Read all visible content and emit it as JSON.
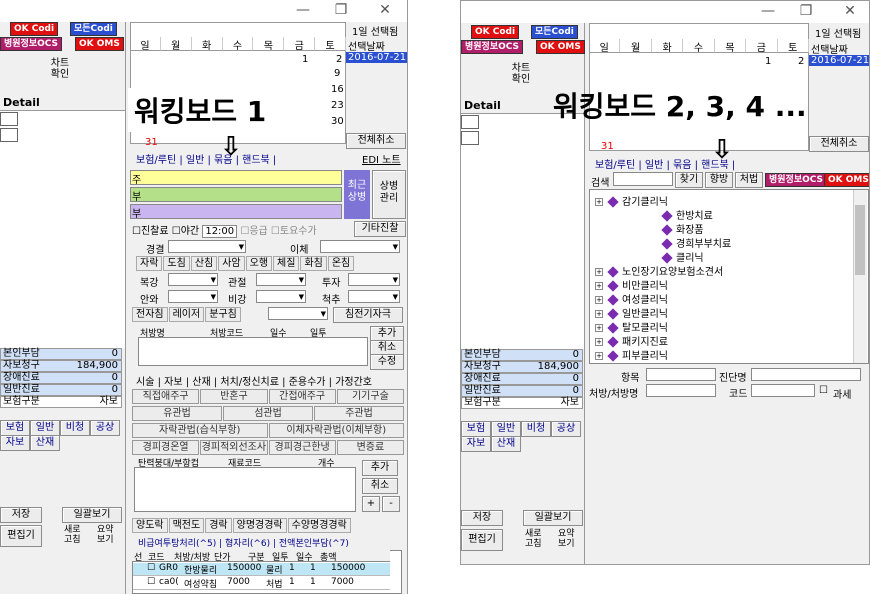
{
  "left": {
    "titlebar": {
      "min": "—",
      "restore": "❐",
      "close": "✕"
    },
    "top_pills": {
      "codi": "OK Codi",
      "allcodi": "모든Codi",
      "ocs": "병원정보OCS",
      "oms": "OK OMS"
    },
    "chart_confirm": "차트\n확인",
    "detail": "Detail",
    "calendar": {
      "days": [
        "일",
        "월",
        "화",
        "수",
        "목",
        "금",
        "토"
      ],
      "row1": [
        "1",
        "2"
      ],
      "side_title": "1일 선택됨",
      "side_label": "선택날짜",
      "side_date": "2016-07-21",
      "side_nums": [
        "9",
        "16",
        "23",
        "30"
      ],
      "sunday_31": "31",
      "cancel_all": "전체취소"
    },
    "caption": "워킹보드 1",
    "tabs": "보험/루틴 | 일반 | 묶음 | 핸드북 |",
    "edi_note": "EDI 노트",
    "diag_rows": [
      "주",
      "부",
      "부"
    ],
    "recent_disease": "최근\n상병",
    "disease_manage": "상병\n관리",
    "check_row": {
      "jinchal": "진찰료",
      "night": "야간",
      "time": "12:00",
      "emerg": "응급",
      "sat": "토요수가",
      "other": "기타진찰"
    },
    "proc1": {
      "kyungkeol": "경결",
      "ichae": "이체"
    },
    "proc_row2": [
      "자락",
      "도침",
      "산침",
      "사암",
      "오행",
      "체질",
      "화침",
      "온침"
    ],
    "proc3": {
      "bokgang": "복강",
      "gwanjeol": "관절",
      "tuja": "투자"
    },
    "proc4": {
      "anoe": "안와",
      "bigang": "비강",
      "cheokchu": "척추"
    },
    "proc5": [
      "전자침",
      "레이저",
      "분구침"
    ],
    "proc5_right": "침전기자극",
    "rx_header": [
      "처방명",
      "처방코드",
      "일수",
      "일투"
    ],
    "rx_buttons": [
      "추가",
      "취소",
      "수정"
    ],
    "section_tabs": "시술 | 자보 | 산재 | 처치/정신치료 | 준용수가 | 가정간호",
    "btn_rows": [
      [
        "직접애주구",
        "반혼구",
        "간접애주구",
        "기기구술"
      ],
      [
        "유관법",
        "섬관법",
        "주관법"
      ],
      [
        "자락관법(습식부항)",
        "이체자락관법(이체부항)"
      ],
      [
        "경피경온열",
        "경피적외선조사",
        "경피경근한냉",
        "변증료"
      ]
    ],
    "mat_header": [
      "탄력붕대/부항컵",
      "재료코드",
      "개수"
    ],
    "mat_buttons": [
      "추가",
      "취소",
      "+",
      "-"
    ],
    "bottom_tabs": [
      "양도락",
      "맥전도",
      "경락",
      "양명경경락",
      "수양명경경락"
    ],
    "fee_tabs": "비급여투탕처리(^5) | 형자리(^6) | 전액본인부담(^7)",
    "rx_table_header": [
      "선",
      "코드",
      "처방/처방",
      "단가",
      "구분",
      "일투",
      "일수",
      "총액"
    ],
    "rx_table_rows": [
      [
        "GR0",
        "한방물리",
        "150000",
        "물리",
        "1",
        "1",
        "150000"
      ],
      [
        "ca0(",
        "여성약침",
        "7000",
        "처법",
        "1",
        "1",
        "7000"
      ]
    ],
    "billing": [
      {
        "label": "본인부담",
        "value": "0"
      },
      {
        "label": "자보청구",
        "value": "184,900"
      },
      {
        "label": "장애진료",
        "value": "0"
      },
      {
        "label": "일반진료",
        "value": "0"
      },
      {
        "label": "보험구분",
        "value": "자보"
      }
    ],
    "insurance_tabs": [
      "보험",
      "일반",
      "비청",
      "공상"
    ],
    "insurance_tabs2": [
      "자보",
      "산재"
    ],
    "save": "저장",
    "bulk_view": "일괄보기",
    "editor": "편집기",
    "new_fetch": "새로\n고침",
    "summary": "요약\n보기"
  },
  "right": {
    "titlebar": {
      "min": "—",
      "restore": "❐",
      "close": "✕"
    },
    "chart_confirm": "차트\n확인",
    "detail": "Detail",
    "calendar": {
      "days": [
        "일",
        "월",
        "화",
        "수",
        "목",
        "금",
        "토"
      ],
      "row1": [
        "1",
        "2"
      ],
      "side_title": "1일 선택됨",
      "side_label": "선택날짜",
      "side_date": "2016-07-21",
      "sunday_31": "31",
      "cancel_all": "전체취소"
    },
    "caption": "워킹보드 2, 3, 4 ...",
    "tabs": "보험/루틴 | 일반 | 묶음 | 핸드북 |",
    "search_label": "검색",
    "find": "찾기",
    "hyangbang": "향방",
    "cheobeop": "처법",
    "tree": [
      {
        "t": "감기클리닉",
        "sub": false
      },
      {
        "t": "한방치료",
        "sub": true
      },
      {
        "t": "화장품",
        "sub": true
      },
      {
        "t": "경희부부치료",
        "sub": true
      },
      {
        "t": "클리닉",
        "sub": true
      },
      {
        "t": "노인장기요양보험소견서",
        "sub": false
      },
      {
        "t": "비만클리닉",
        "sub": false
      },
      {
        "t": "여성클리닉",
        "sub": false
      },
      {
        "t": "일반클리닉",
        "sub": false
      },
      {
        "t": "탈모클리닉",
        "sub": false
      },
      {
        "t": "패키지진료",
        "sub": false
      },
      {
        "t": "피부클리닉",
        "sub": false
      }
    ],
    "item_label": "항목",
    "diag_name": "진단명",
    "rx_label": "처방/처방명",
    "code": "코드",
    "taxable": "과세",
    "billing": [
      {
        "label": "본인부담",
        "value": "0"
      },
      {
        "label": "자보청구",
        "value": "184,900"
      },
      {
        "label": "장애진료",
        "value": "0"
      },
      {
        "label": "일반진료",
        "value": "0"
      },
      {
        "label": "보험구분",
        "value": "자보"
      }
    ],
    "insurance_tabs": [
      "보험",
      "일반",
      "비청",
      "공상"
    ],
    "insurance_tabs2": [
      "자보",
      "산재"
    ],
    "save": "저장",
    "bulk_view": "일괄보기",
    "editor": "편집기",
    "new_fetch": "새로\n고침",
    "summary": "요약\n보기"
  }
}
